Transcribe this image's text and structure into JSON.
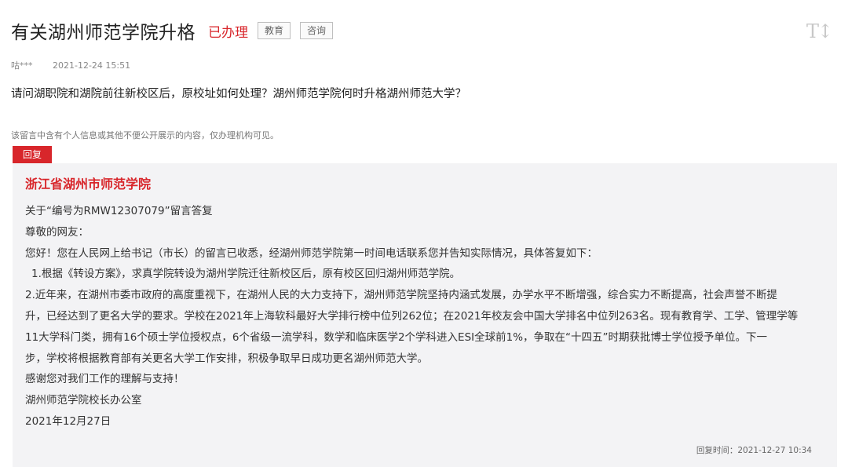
{
  "header": {
    "title": "有关湖州师范学院升格",
    "status": "已办理",
    "tags": [
      "教育",
      "咨询"
    ],
    "font_toggle": "T↕"
  },
  "meta": {
    "author": "咕***",
    "time": "2021-12-24 15:51"
  },
  "question": "请问湖职院和湖院前往新校区后，原校址如何处理？湖州师范学院何时升格湖州师范大学？",
  "privacy_notice": "该留言中含有个人信息或其他不便公开展示的内容，仅办理机构可见。",
  "reply": {
    "badge": "回复",
    "organization": "浙江省湖州市师范学院",
    "lines": [
      "关于“编号为RMW12307079”留言答复",
      "尊敬的网友：",
      "您好！您在人民网上给书记（市长）的留言已收悉，经湖州师范学院第一时间电话联系您并告知实际情况，具体答复如下：",
      "1.根据《转设方案》，求真学院转设为湖州学院迁往新校区后，原有校区回归湖州师范学院。",
      "2.近年来，在湖州市委市政府的高度重视下，在湖州人民的大力支持下，湖州师范学院坚持内涵式发展，办学水平不断增强，综合实力不断提高，社会声誉不断提",
      "升，已经达到了更名大学的要求。学校在2021年上海软科最好大学排行榜中位列262位；在2021年校友会中国大学排名中位列263名。现有教育学、工学、管理学等",
      "11大学科门类，拥有16个硕士学位授权点，6个省级一流学科，数学和临床医学2个学科进入ESI全球前1%，争取在“十四五”时期获批博士学位授予单位。下一",
      "步，学校将根据教育部有关更名大学工作安排，积极争取早日成功更名湖州师范大学。",
      "感谢您对我们工作的理解与支持！",
      "湖州师范学院校长办公室",
      "2021年12月27日"
    ],
    "reply_time": "回复时间：2021-12-27 10:34"
  }
}
